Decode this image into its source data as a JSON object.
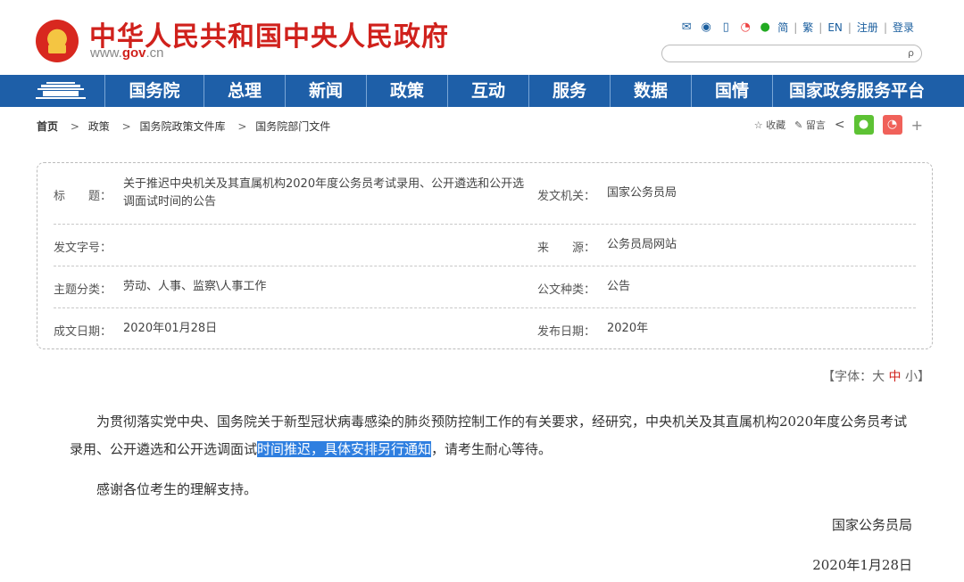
{
  "header": {
    "site_title": "中华人民共和国中央人民政府",
    "url_prefix": "www.",
    "url_brand": "gov",
    "url_suffix": ".cn",
    "tools": {
      "simplified": "简",
      "traditional": "繁",
      "english": "EN",
      "register": "注册",
      "login": "登录",
      "sep": "|"
    },
    "search_placeholder": ""
  },
  "nav": {
    "items": [
      "国务院",
      "总理",
      "新闻",
      "政策",
      "互动",
      "服务",
      "数据",
      "国情",
      "国家政务服务平台"
    ]
  },
  "breadcrumb": {
    "home": "首页",
    "items": [
      "政策",
      "国务院政策文件库",
      "国务院部门文件"
    ],
    "arrow": ">"
  },
  "share": {
    "favorite": "收藏",
    "comment": "留言",
    "plus": "+"
  },
  "info": {
    "title_label": "标　　题：",
    "title_value": "关于推迟中央机关及其直属机构2020年度公务员考试录用、公开遴选和公开选调面试时间的公告",
    "issuer_label": "发文机关：",
    "issuer_value": "国家公务员局",
    "docno_label": "发文字号：",
    "docno_value": "",
    "source_label": "来　　源：",
    "source_value": "公务员局网站",
    "topic_label": "主题分类：",
    "topic_value": "劳动、人事、监察\\人事工作",
    "type_label": "公文种类：",
    "type_value": "公告",
    "written_label": "成文日期：",
    "written_value": "2020年01月28日",
    "published_label": "发布日期：",
    "published_value": "2020年"
  },
  "fontsize": {
    "open": "【字体：",
    "large": "大",
    "medium": "中",
    "small": "小",
    "close": "】"
  },
  "body": {
    "p1_before": "为贯彻落实党中央、国务院关于新型冠状病毒感染的肺炎预防控制工作的有关要求，经研究，中央机关及其直属机构2020年度公务员考试录用、公开遴选和公开选调面试",
    "p1_highlight": "时间推迟，具体安排另行通知",
    "p1_after": "，请考生耐心等待。",
    "p2": "感谢各位考生的理解支持。",
    "signature": "国家公务员局",
    "date": "2020年1月28日"
  },
  "colors": {
    "brand_red": "#d0211c",
    "nav_blue": "#1e5fa8",
    "highlight": "#2f7fe0"
  }
}
